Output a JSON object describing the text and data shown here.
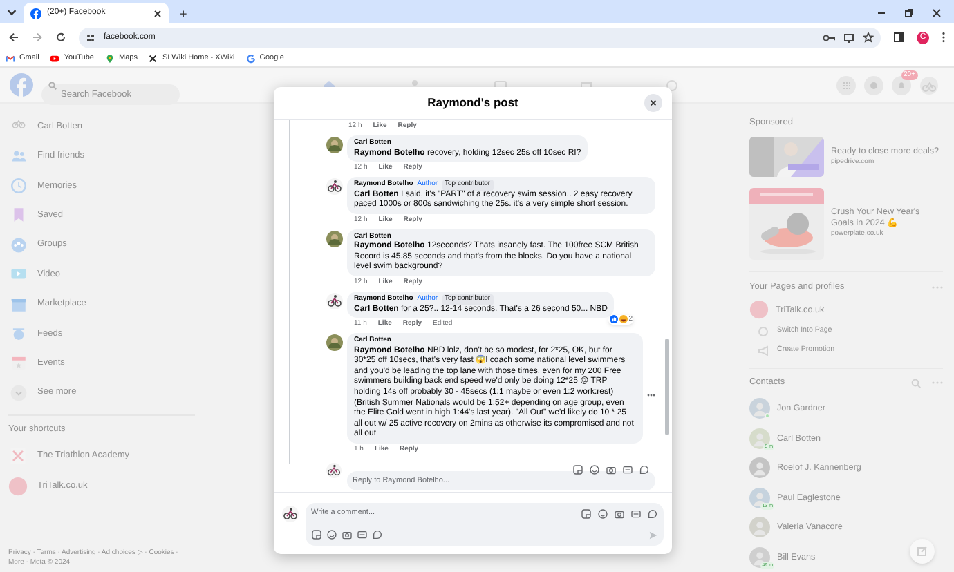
{
  "browser": {
    "tabs": [
      {
        "title": "(20+) Facebook",
        "selected": true
      }
    ],
    "new_tab": "+",
    "url": "facebook.com",
    "profile_initial": "C",
    "bookmarks": [
      "Gmail",
      "YouTube",
      "Maps",
      "SI Wiki Home - XWiki",
      "Google"
    ]
  },
  "header": {
    "search": {
      "placeholder": "Search Facebook"
    },
    "notifications_badge": "20+"
  },
  "left_nav": {
    "items": [
      "Carl Botten",
      "Find friends",
      "Memories",
      "Saved",
      "Groups",
      "Video",
      "Marketplace",
      "Feeds",
      "Events",
      "See more"
    ],
    "shortcuts_heading": "Your shortcuts",
    "shortcuts": [
      "The Triathlon Academy",
      "TriTalk.co.uk"
    ],
    "footer": [
      "Privacy · Terms · Advertising · Ad choices ▷ · Cookies ·",
      "More · Meta © 2024"
    ]
  },
  "right_sidebar": {
    "sponsored_heading": "Sponsored",
    "ads": [
      {
        "title": "Ready to close more deals?",
        "domain": "pipedrive.com"
      },
      {
        "title": "Crush Your New Year's Goals in 2024 💪",
        "domain": "powerplate.co.uk"
      }
    ],
    "pages_heading": "Your Pages and profiles",
    "pages": [
      "TriTalk.co.uk"
    ],
    "page_actions": [
      "Switch Into Page",
      "Create Promotion"
    ],
    "contacts_heading": "Contacts",
    "contacts": [
      {
        "name": "Jon Gardner",
        "online": true
      },
      {
        "name": "Carl Botten",
        "online": false,
        "badge": "5 m"
      },
      {
        "name": "Roelof J. Kannenberg",
        "online": false
      },
      {
        "name": "Paul Eaglestone",
        "online": false,
        "badge": "13 m"
      },
      {
        "name": "Valeria Vanacore",
        "online": false
      },
      {
        "name": "Bill Evans",
        "online": false,
        "badge": "49 m"
      }
    ]
  },
  "post_dialog": {
    "title": "Raymond's post",
    "top_meta": {
      "time": "12 h",
      "actions": [
        "Like",
        "Reply"
      ]
    },
    "comments": [
      {
        "author": "Carl Botten",
        "text": "**Raymond Botelho** recovery, holding 12sec 25s off 10sec RI?",
        "time": "12 h",
        "actions": [
          "Like",
          "Reply"
        ]
      },
      {
        "author": "Raymond Botelho",
        "badges": [
          "Author",
          "Top contributor"
        ],
        "text": "**Carl Botten** I said, it's \"PART\" of a recovery swim session.. 2 easy recovery paced 1000s or 800s sandwiching the 25s. it's a very simple short session.",
        "time": "12 h",
        "actions": [
          "Like",
          "Reply"
        ]
      },
      {
        "author": "Carl Botten",
        "text": "**Raymond Botelho** 12seconds? Thats insanely fast. The 100free SCM British Record is 45.85 seconds and that's from the blocks. Do you have a national level swim background?",
        "time": "12 h",
        "actions": [
          "Like",
          "Reply"
        ]
      },
      {
        "author": "Raymond Botelho",
        "badges": [
          "Author",
          "Top contributor"
        ],
        "text": "**Carl Botten** for a 25?.. 12-14 seconds. That's a 26 second 50... NBD",
        "time": "11 h",
        "actions": [
          "Like",
          "Reply"
        ],
        "edited": "Edited",
        "reactions": "2"
      },
      {
        "author": "Carl Botten",
        "text": "**Raymond Botelho** NBD lolz, don't be so modest, for 2*25, OK, but for 30*25 off 10secs, that's very fast 😱I coach some national level swimmers and you'd be leading the top lane with those times, even for my 200 Free swimmers building back end speed we'd only be doing 12*25 @ TRP holding 14s off probably 30 - 45secs (1:1 maybe or even 1:2 work:rest) (British Summer Nationals would be 1:52+ depending on age group, even the Elite Gold went in high 1:44's last year). \"All Out\" we'd likely do 10 * 25 all out w/ 25 active recovery on 2mins as otherwise its compromised and not all out",
        "time": "1 h",
        "actions": [
          "Like",
          "Reply"
        ]
      }
    ],
    "reply": {
      "placeholder": "Reply to Raymond Botelho..."
    },
    "comment": {
      "placeholder": "Write a comment..."
    }
  }
}
